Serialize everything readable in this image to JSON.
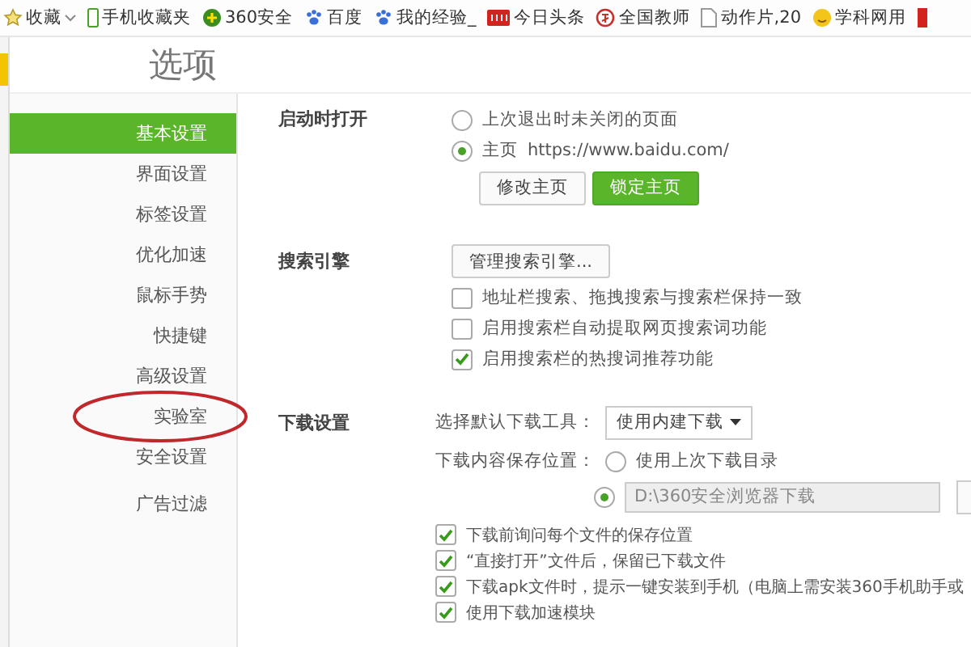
{
  "bookmarks": [
    {
      "label": "收藏",
      "kind": "star",
      "dropdown": true
    },
    {
      "label": "手机收藏夹",
      "kind": "phone",
      "dropdown": false
    },
    {
      "label": "360安全",
      "kind": "plus",
      "dropdown": false
    },
    {
      "label": "百度",
      "kind": "paw",
      "dropdown": false
    },
    {
      "label": "我的经验_",
      "kind": "paw",
      "dropdown": false
    },
    {
      "label": "今日头条",
      "kind": "news",
      "dropdown": false
    },
    {
      "label": "全国教师",
      "kind": "seal",
      "dropdown": false
    },
    {
      "label": "动作片,20",
      "kind": "page",
      "dropdown": false
    },
    {
      "label": "学科网用",
      "kind": "face",
      "dropdown": false
    }
  ],
  "title": "选项",
  "sidebar": {
    "items": [
      {
        "label": "基本设置",
        "selected": true,
        "circled": false
      },
      {
        "label": "界面设置",
        "selected": false,
        "circled": false
      },
      {
        "label": "标签设置",
        "selected": false,
        "circled": false
      },
      {
        "label": "优化加速",
        "selected": false,
        "circled": false
      },
      {
        "label": "鼠标手势",
        "selected": false,
        "circled": false
      },
      {
        "label": "快捷键",
        "selected": false,
        "circled": false
      },
      {
        "label": "高级设置",
        "selected": false,
        "circled": false
      },
      {
        "label": "实验室",
        "selected": false,
        "circled": true
      },
      {
        "label": "安全设置",
        "selected": false,
        "circled": false
      },
      {
        "label": "广告过滤",
        "selected": false,
        "circled": false
      }
    ]
  },
  "startup": {
    "label": "启动时打开",
    "options": [
      {
        "label": "上次退出时未关闭的页面",
        "selected": false
      },
      {
        "label": "主页",
        "url": "https://www.baidu.com/",
        "selected": true
      }
    ],
    "buttons": [
      {
        "label": "修改主页",
        "primary": false
      },
      {
        "label": "锁定主页",
        "primary": true
      }
    ]
  },
  "search": {
    "label": "搜索引擎",
    "manage_button": "管理搜索引擎...",
    "options": [
      {
        "label": "地址栏搜索、拖拽搜索与搜索栏保持一致",
        "checked": false
      },
      {
        "label": "启用搜索栏自动提取网页搜索词功能",
        "checked": false
      },
      {
        "label": "启用搜索栏的热搜词推荐功能",
        "checked": true
      }
    ]
  },
  "download": {
    "label": "下载设置",
    "tool_label": "选择默认下载工具：",
    "tool_value": "使用内建下载",
    "location_label": "下载内容保存位置：",
    "locations": [
      {
        "label": "使用上次下载目录",
        "selected": false
      },
      {
        "path": "D:\\360安全浏览器下载",
        "selected": true
      }
    ],
    "options": [
      {
        "label": "下载前询问每个文件的保存位置",
        "checked": true
      },
      {
        "label": "“直接打开”文件后，保留已下载文件",
        "checked": true
      },
      {
        "label": "下载apk文件时，提示一键安装到手机（电脑上需安装360手机助手或",
        "checked": true
      },
      {
        "label": "使用下载加速模块",
        "checked": true
      }
    ]
  }
}
